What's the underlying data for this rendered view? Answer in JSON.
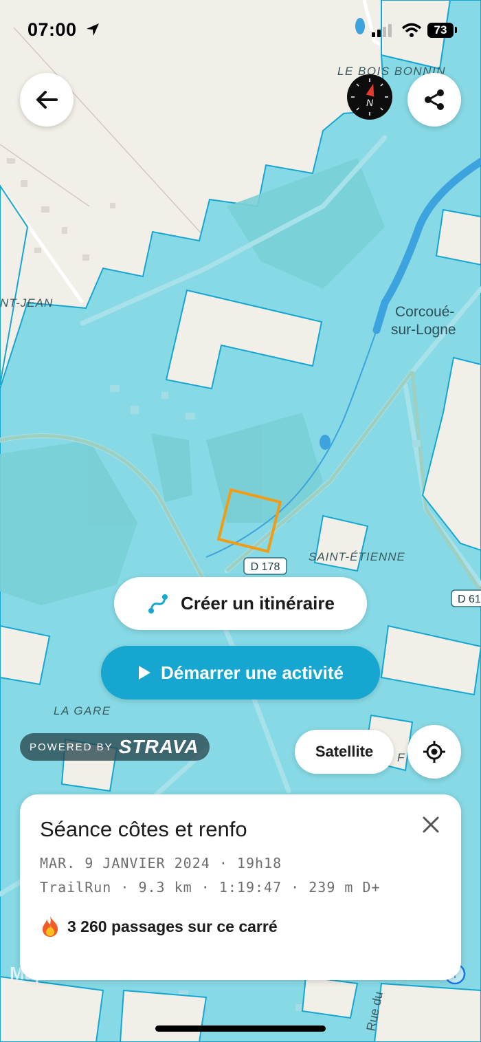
{
  "status_bar": {
    "time": "07:00",
    "battery": "73"
  },
  "map": {
    "labels": {
      "le_bois_bonnin": "LE BOIS BONNIN",
      "nt_jean": "NT-JEAN",
      "corcoue_1": "Corcoué-",
      "corcoue_2": "sur-Logne",
      "saint_etienne": "SAINT-ÉTIENNE",
      "la_gare": "LA GARE",
      "d178": "D 178",
      "d61": "D 61",
      "rue_du": "Rue du",
      "f_fragment": "F"
    },
    "colors": {
      "land": "#f2efe9",
      "tiles": "#86d9e5",
      "tile_edge": "#16a6cf",
      "square": "#f39c12",
      "river": "#3da3de"
    }
  },
  "buttons": {
    "create_route": "Créer un itinéraire",
    "start_activity": "Démarrer une activité",
    "satellite": "Satellite"
  },
  "attribution": {
    "powered_by": "POWERED BY",
    "brand": "STRAVA",
    "maplibre": "MapLibre"
  },
  "card": {
    "title": "Séance côtes et renfo",
    "date": "MAR. 9 JANVIER 2024 · 19h18",
    "stats": "TrailRun · 9.3 km · 1:19:47 · 239 m D+",
    "passages": "3 260 passages sur ce carré",
    "passages_icon": "fire-icon"
  },
  "icons": [
    "arrow-left-icon",
    "compass-icon",
    "share-icon",
    "route-icon",
    "play-icon",
    "locate-icon",
    "close-icon",
    "info-icon"
  ]
}
